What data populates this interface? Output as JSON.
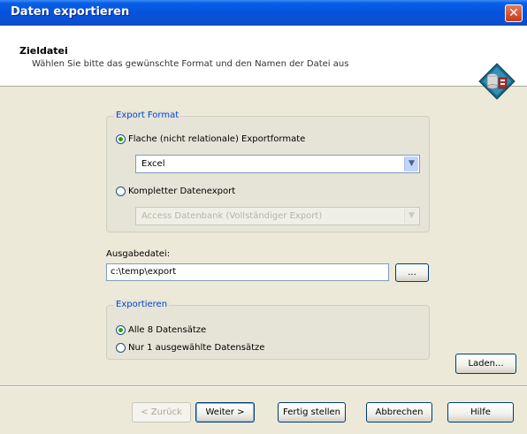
{
  "window": {
    "title": "Daten exportieren"
  },
  "header": {
    "title": "Zieldatei",
    "subtitle": "Wählen Sie bitte das gewünschte Format und den Namen der Datei aus"
  },
  "export_format": {
    "legend": "Export Format",
    "flat_option": "Flache (nicht relationale) Exportformate",
    "flat_selected": true,
    "flat_format_value": "Excel",
    "complete_option": "Kompletter Datenexport",
    "complete_format_value": "Access Datenbank (Vollständiger Export)"
  },
  "output": {
    "label": "Ausgabedatei:",
    "path": "c:\\temp\\export",
    "browse": "..."
  },
  "exportieren": {
    "legend": "Exportieren",
    "all_option": "Alle 8 Datensätze",
    "all_selected": true,
    "selected_option": "Nur 1 ausgewählte Datensätze"
  },
  "buttons": {
    "load": "Laden...",
    "back": "< Zurück",
    "next": "Weiter >",
    "finish": "Fertig stellen",
    "cancel": "Abbrechen",
    "help": "Hilfe"
  },
  "colors": {
    "title_bar": "#0553dc",
    "legend": "#0046d5",
    "close": "#c63a18"
  }
}
